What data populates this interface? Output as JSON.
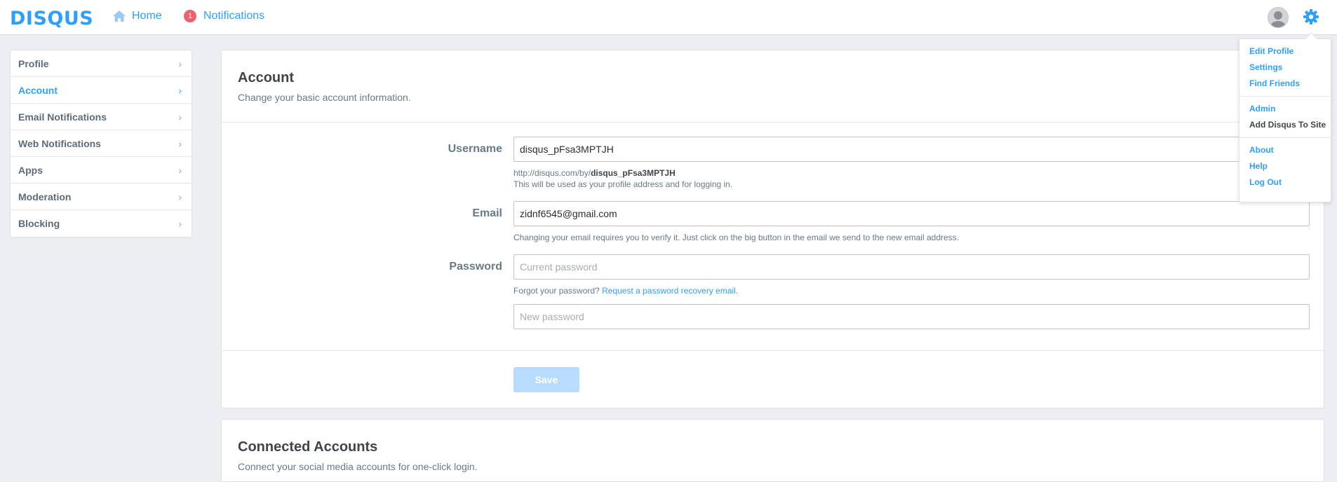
{
  "header": {
    "logo": "DISQUS",
    "home_label": "Home",
    "notifications_label": "Notifications",
    "notifications_count": "1"
  },
  "sidebar": {
    "items": [
      {
        "label": "Profile"
      },
      {
        "label": "Account"
      },
      {
        "label": "Email Notifications"
      },
      {
        "label": "Web Notifications"
      },
      {
        "label": "Apps"
      },
      {
        "label": "Moderation"
      },
      {
        "label": "Blocking"
      }
    ],
    "active": "Account"
  },
  "account": {
    "title": "Account",
    "subtitle": "Change your basic account information.",
    "username_label": "Username",
    "username_value": "disqus_pFsa3MPTJH",
    "profile_url_prefix": "http://disqus.com/by/",
    "profile_url_user": "disqus_pFsa3MPTJH",
    "username_help": "This will be used as your profile address and for logging in.",
    "email_label": "Email",
    "email_value": "zidnf6545@gmail.com",
    "email_help": "Changing your email requires you to verify it. Just click on the big button in the email we send to the new email address.",
    "password_label": "Password",
    "current_password_placeholder": "Current password",
    "forgot_text": "Forgot your password?",
    "recovery_link": "Request a password recovery email.",
    "new_password_placeholder": "New password",
    "save_label": "Save"
  },
  "connected": {
    "title": "Connected Accounts",
    "subtitle": "Connect your social media accounts for one-click login."
  },
  "dropdown": {
    "groups": [
      [
        {
          "label": "Edit Profile"
        },
        {
          "label": "Settings"
        },
        {
          "label": "Find Friends"
        }
      ],
      [
        {
          "label": "Admin"
        },
        {
          "label": "Add Disqus To Site"
        }
      ],
      [
        {
          "label": "About"
        },
        {
          "label": "Help"
        },
        {
          "label": "Log Out"
        }
      ]
    ]
  },
  "colors": {
    "accent": "#2e9fff",
    "badge": "#f05f70",
    "background": "#eceef1"
  }
}
